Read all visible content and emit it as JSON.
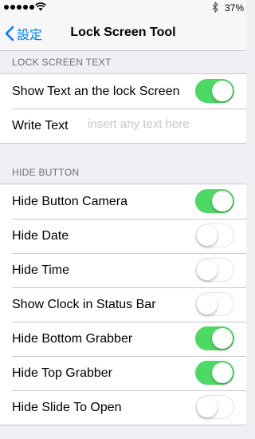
{
  "status_bar": {
    "battery_percent": "37%"
  },
  "nav": {
    "back_label": "設定",
    "title": "Lock Screen Tool"
  },
  "section_text": {
    "header": "LOCK SCREEN TEXT",
    "show_text_label": "Show Text an the lock Screen",
    "show_text_on": true,
    "write_text_label": "Write Text",
    "write_text_value": "",
    "write_text_placeholder": "insert any text here"
  },
  "section_hide": {
    "header": "HIDE BUTTON",
    "items": [
      {
        "label": "Hide Button Camera",
        "on": true
      },
      {
        "label": "Hide Date",
        "on": false
      },
      {
        "label": "Hide Time",
        "on": false
      },
      {
        "label": "Show Clock in Status Bar",
        "on": false
      },
      {
        "label": "Hide Bottom Grabber",
        "on": true
      },
      {
        "label": "Hide Top Grabber",
        "on": true
      },
      {
        "label": "Hide Slide To Open",
        "on": false
      }
    ]
  },
  "colors": {
    "accent": "#007aff",
    "toggle_on": "#4cd964",
    "background": "#efeff4"
  }
}
